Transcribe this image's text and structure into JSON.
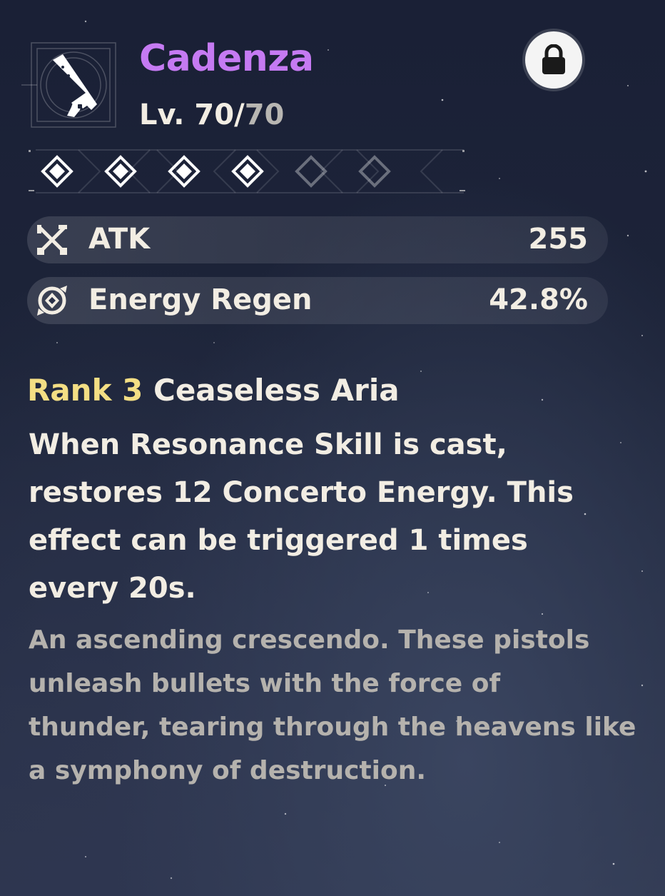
{
  "weapon": {
    "name": "Cadenza",
    "name_color": "#c57af2",
    "icon": "pistol-icon",
    "level_label": "Lv. 70/",
    "level_max": "70",
    "locked": true,
    "lock_icon": "lock-icon"
  },
  "rank": {
    "filled": 4,
    "total": 6
  },
  "stats": [
    {
      "icon": "crossed-swords-icon",
      "label": "ATK",
      "value": "255"
    },
    {
      "icon": "energy-regen-icon",
      "label": "Energy Regen",
      "value": "42.8%"
    }
  ],
  "passive": {
    "rank_label": "Rank 3",
    "rank_color": "#f3de84",
    "name": "Ceaseless Aria",
    "description_lines": [
      "When Resonance Skill is cast,",
      "restores 12 Concerto Energy. This",
      "effect can be triggered 1 times",
      "every 20s."
    ]
  },
  "flavor_lines": [
    "An ascending crescendo. These pistols",
    "unleash bullets with the force of",
    "thunder, tearing through the heavens like",
    "a symphony of destruction."
  ]
}
